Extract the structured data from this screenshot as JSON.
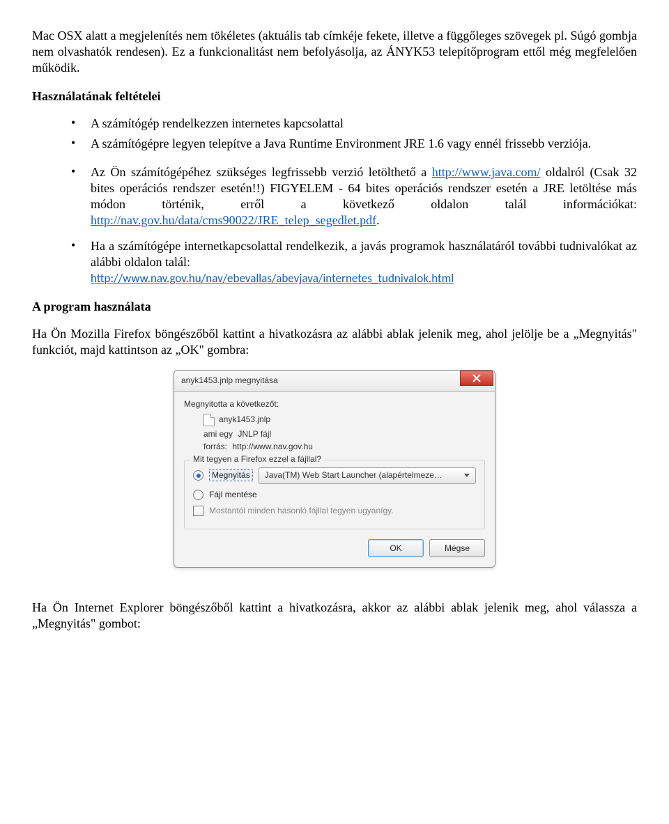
{
  "intro_paragraph": "Mac OSX alatt a megjelenítés nem tökéletes (aktuális tab címkéje fekete, illetve a függőleges szövegek pl. Súgó gombja nem olvashatók rendesen). Ez a funkcionalitást nem befolyásolja, az ÁNYK53 telepítőprogram ettől még megfelelően működik.",
  "requirements_heading": "Használatának feltételei",
  "requirements": [
    "A számítógép rendelkezzen internetes kapcsolattal",
    "A számítógépre legyen telepítve a Java Runtime Environment JRE 1.6 vagy ennél frissebb verziója."
  ],
  "para_java_pre": "Az Ön számítógépéhez szükséges legfrissebb verzió letölthető a ",
  "para_java_link": "http://www.java.com/",
  "para_java_mid": " oldalról (Csak 32 bites operációs rendszer esetén!!) FIGYELEM - 64 bites operációs rendszer esetén a JRE letöltése más módon történik, erről a következő oldalon talál információkat: ",
  "para_java_link2": "http://nav.gov.hu/data/cms90022/JRE_telep_segedlet.pdf",
  "para_java_post": ".",
  "para_info": "Ha a számítógépe internetkapcsolattal rendelkezik, a javás programok használatáról további tudnivalókat az alábbi oldalon talál:",
  "info_link": "http://www.nav.gov.hu/nav/ebevallas/abevjava/internetes_tudnivalok.html",
  "usage_heading": "A program használata",
  "usage_para": "Ha Ön Mozilla Firefox böngészőből kattint a hivatkozásra az alábbi ablak jelenik meg, ahol jelölje be a „Megnyitás\" funkciót, majd kattintson az „OK\" gombra:",
  "dialog": {
    "title": "anyk1453.jnlp megnyitása",
    "opened_label": "Megnyitotta a következőt:",
    "filename": "anyk1453.jnlp",
    "type_label": "ami egy",
    "type_value": "JNLP fájl",
    "source_label": "forrás:",
    "source_value": "http://www.nav.gov.hu",
    "action_question": "Mit tegyen a Firefox ezzel a fájllal?",
    "open_label": "Megnyitás",
    "open_with_value": "Java(TM) Web Start Launcher (alapértelmeze…",
    "save_label": "Fájl mentése",
    "remember_label": "Mostantól minden hasonló fájllal tegyen ugyanígy.",
    "ok": "OK",
    "cancel": "Mégse"
  },
  "closing_para": "Ha Ön Internet Explorer böngészőből kattint a hivatkozásra, akkor az alábbi ablak jelenik meg, ahol válassza a „Megnyitás\" gombot:"
}
